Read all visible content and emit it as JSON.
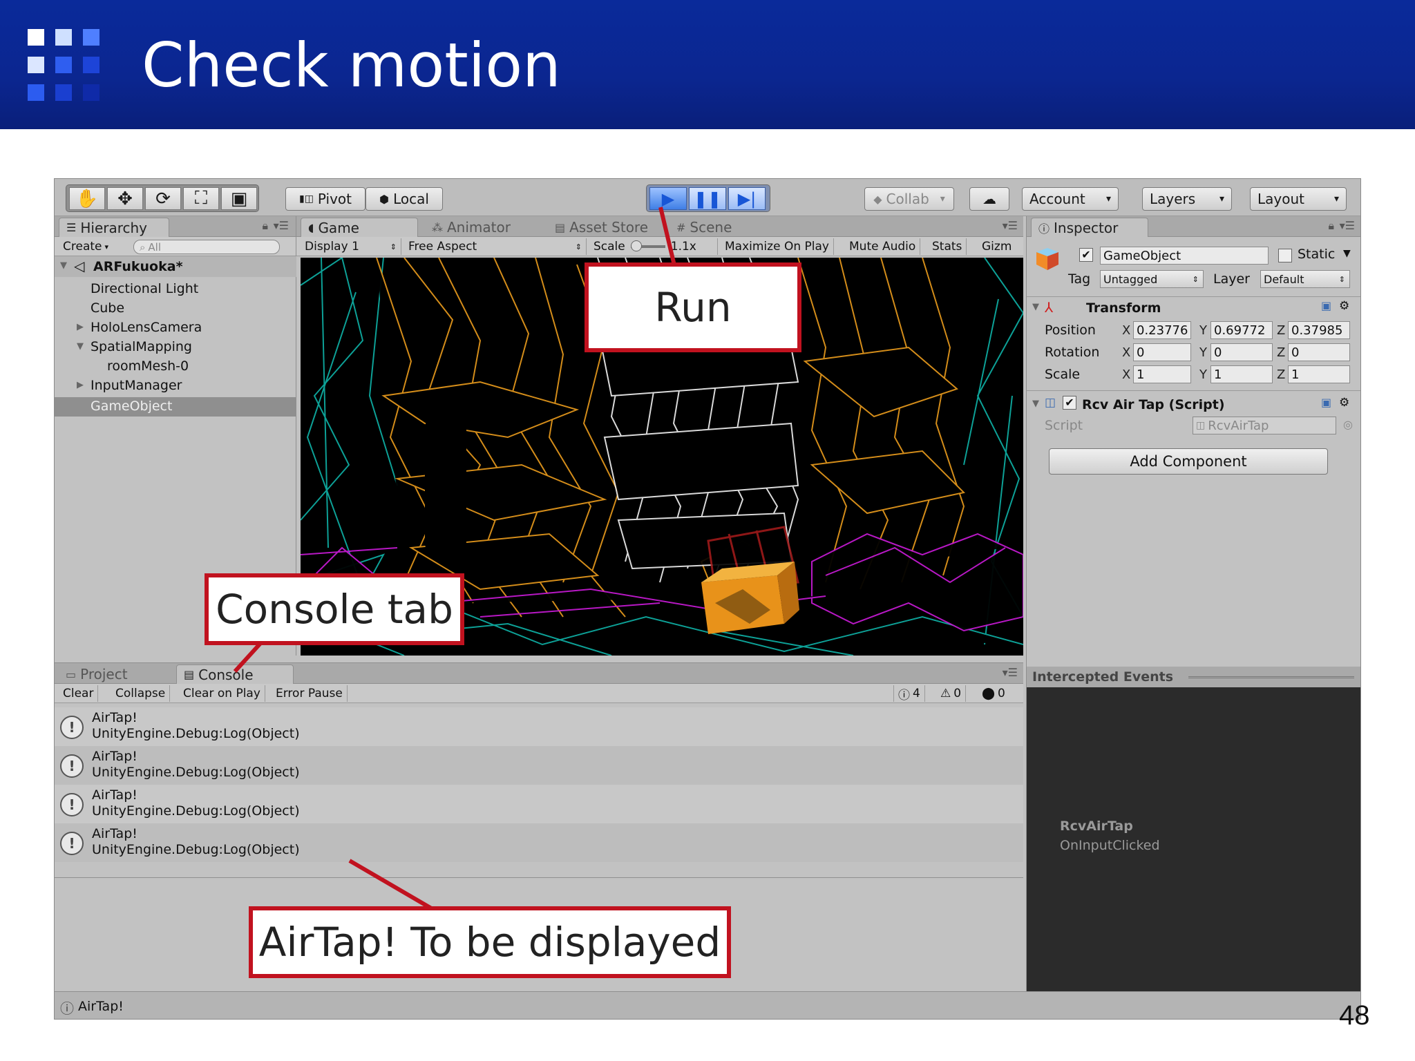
{
  "slide": {
    "title": "Check motion",
    "page_number": "48",
    "colors": {
      "header": "#0b2690",
      "callout_border": "#c1121f",
      "play_blue": "#3f7fe6"
    }
  },
  "toolbar": {
    "tools": [
      "hand-icon",
      "move-icon",
      "rotate-icon",
      "scale-icon",
      "rect-icon"
    ],
    "pivot": "Pivot",
    "local": "Local",
    "collab": "Collab",
    "account": "Account",
    "layers": "Layers",
    "layout": "Layout"
  },
  "hierarchy": {
    "tab": "Hierarchy",
    "create": "Create",
    "search_placeholder": "All",
    "scene": "ARFukuoka*",
    "items": [
      "Directional Light",
      "Cube",
      "HoloLensCamera",
      "SpatialMapping",
      "roomMesh-0",
      "InputManager",
      "GameObject"
    ]
  },
  "center": {
    "tabs": [
      "Game",
      "Animator",
      "Asset Store",
      "Scene"
    ],
    "display": "Display 1",
    "aspect": "Free Aspect",
    "scale_label": "Scale",
    "scale_value": "1.1x",
    "maximize": "Maximize On Play",
    "mute": "Mute Audio",
    "stats": "Stats",
    "gizmos": "Gizm"
  },
  "inspector": {
    "tab": "Inspector",
    "object_name": "GameObject",
    "static_label": "Static",
    "tag_label": "Tag",
    "tag_value": "Untagged",
    "layer_label": "Layer",
    "layer_value": "Default",
    "transform_title": "Transform",
    "position_label": "Position",
    "rotation_label": "Rotation",
    "scale_label": "Scale",
    "position": [
      "0.23776",
      "0.69772",
      "0.37985"
    ],
    "rotation": [
      "0",
      "0",
      "0"
    ],
    "scale": [
      "1",
      "1",
      "1"
    ],
    "axis_x": "X",
    "axis_y": "Y",
    "axis_z": "Z",
    "script_component": "Rcv Air Tap (Script)",
    "script_label": "Script",
    "script_value": "RcvAirTap",
    "add_component": "Add Component",
    "events_title": "Intercepted Events",
    "event_name": "RcvAirTap",
    "event_method": "OnInputClicked"
  },
  "bottom": {
    "tab_project": "Project",
    "tab_console": "Console",
    "clear": "Clear",
    "collapse": "Collapse",
    "clear_on_play": "Clear on Play",
    "error_pause": "Error Pause",
    "count_info": "4",
    "count_warn": "0",
    "count_error": "0",
    "logs": [
      {
        "line1": "AirTap!",
        "line2": "UnityEngine.Debug:Log(Object)"
      },
      {
        "line1": "AirTap!",
        "line2": "UnityEngine.Debug:Log(Object)"
      },
      {
        "line1": "AirTap!",
        "line2": "UnityEngine.Debug:Log(Object)"
      },
      {
        "line1": "AirTap!",
        "line2": "UnityEngine.Debug:Log(Object)"
      }
    ],
    "status": "AirTap!"
  },
  "callouts": {
    "run": "Run",
    "console_tab": "Console tab",
    "airtap": "AirTap! To be displayed"
  }
}
